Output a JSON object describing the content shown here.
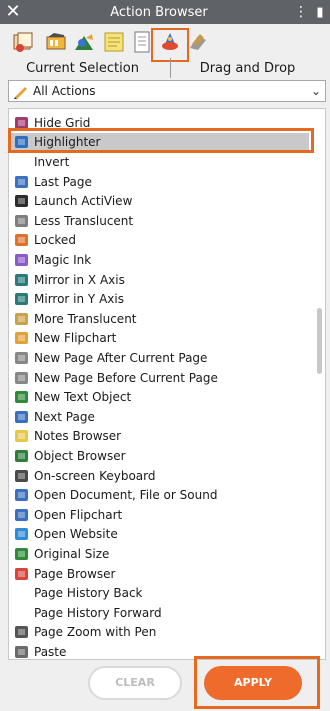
{
  "window": {
    "title": "Action Browser",
    "close_glyph": "✕",
    "menu_glyph": "⋮",
    "pin_glyph": "▮"
  },
  "toolbar": {
    "icons": [
      "page-browser-icon",
      "resource-browser-icon",
      "object-browser-icon",
      "notes-browser-icon",
      "page-browser-icon-2",
      "action-browser-icon",
      "property-browser-icon"
    ]
  },
  "tabs": {
    "current_selection": "Current Selection",
    "drag_and_drop": "Drag and Drop"
  },
  "filter": {
    "selected": "All Actions",
    "icon": "pen-icon"
  },
  "actions": [
    {
      "label": "Hide Grid",
      "icon": "grid-icon"
    },
    {
      "label": "Highlighter",
      "icon": "highlighter-icon",
      "selected": true
    },
    {
      "label": "Invert",
      "icon": ""
    },
    {
      "label": "Last Page",
      "icon": "last-page-icon"
    },
    {
      "label": "Launch ActiView",
      "icon": "actiview-icon"
    },
    {
      "label": "Less Translucent",
      "icon": "less-translucent-icon"
    },
    {
      "label": "Locked",
      "icon": "lock-icon"
    },
    {
      "label": "Magic Ink",
      "icon": "magic-ink-icon"
    },
    {
      "label": "Mirror in X Axis",
      "icon": "mirror-x-icon"
    },
    {
      "label": "Mirror in Y Axis",
      "icon": "mirror-y-icon"
    },
    {
      "label": "More Translucent",
      "icon": "more-translucent-icon"
    },
    {
      "label": "New Flipchart",
      "icon": "new-flipchart-icon"
    },
    {
      "label": "New Page After Current Page",
      "icon": "new-page-after-icon"
    },
    {
      "label": "New Page Before Current Page",
      "icon": "new-page-before-icon"
    },
    {
      "label": "New Text Object",
      "icon": "new-text-icon"
    },
    {
      "label": "Next Page",
      "icon": "next-page-icon"
    },
    {
      "label": "Notes Browser",
      "icon": "notes-browser-icon"
    },
    {
      "label": "Object Browser",
      "icon": "object-browser-icon"
    },
    {
      "label": "On-screen Keyboard",
      "icon": "keyboard-icon"
    },
    {
      "label": "Open Document, File or Sound",
      "icon": "open-document-icon"
    },
    {
      "label": "Open Flipchart",
      "icon": "open-flipchart-icon"
    },
    {
      "label": "Open Website",
      "icon": "website-icon"
    },
    {
      "label": "Original Size",
      "icon": "original-size-icon"
    },
    {
      "label": "Page Browser",
      "icon": "page-browser-icon"
    },
    {
      "label": "Page History Back",
      "icon": ""
    },
    {
      "label": "Page History Forward",
      "icon": ""
    },
    {
      "label": "Page Zoom with Pen",
      "icon": "zoom-icon"
    },
    {
      "label": "Paste",
      "icon": "paste-icon"
    }
  ],
  "footer": {
    "clear_label": "CLEAR",
    "apply_label": "APPLY"
  },
  "colors": {
    "accent": "#e5691f",
    "apply": "#ef6b2c",
    "titlebar": "#5f6368"
  }
}
